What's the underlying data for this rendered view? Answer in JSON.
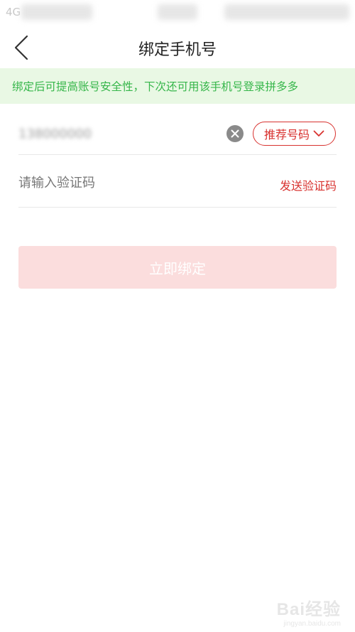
{
  "status_bar": {
    "left_text": "4G"
  },
  "header": {
    "title": "绑定手机号",
    "back_icon": "chevron-left-icon"
  },
  "notice": {
    "text": "绑定后可提高账号安全性，下次还可用该手机号登录拼多多"
  },
  "phone_field": {
    "value": "138000000",
    "clear_icon": "clear-circle-icon",
    "recommend_label": "推荐号码",
    "recommend_icon": "chevron-down-icon"
  },
  "code_field": {
    "placeholder": "请输入验证码",
    "send_label": "发送验证码"
  },
  "submit": {
    "label": "立即绑定"
  },
  "watermark": {
    "logo": "Bai经验",
    "url": "jingyan.baidu.com"
  },
  "colors": {
    "accent": "#d8322f",
    "notice_bg": "#e9f8e4",
    "notice_text": "#36b64a",
    "button_disabled": "#fbdddd"
  }
}
